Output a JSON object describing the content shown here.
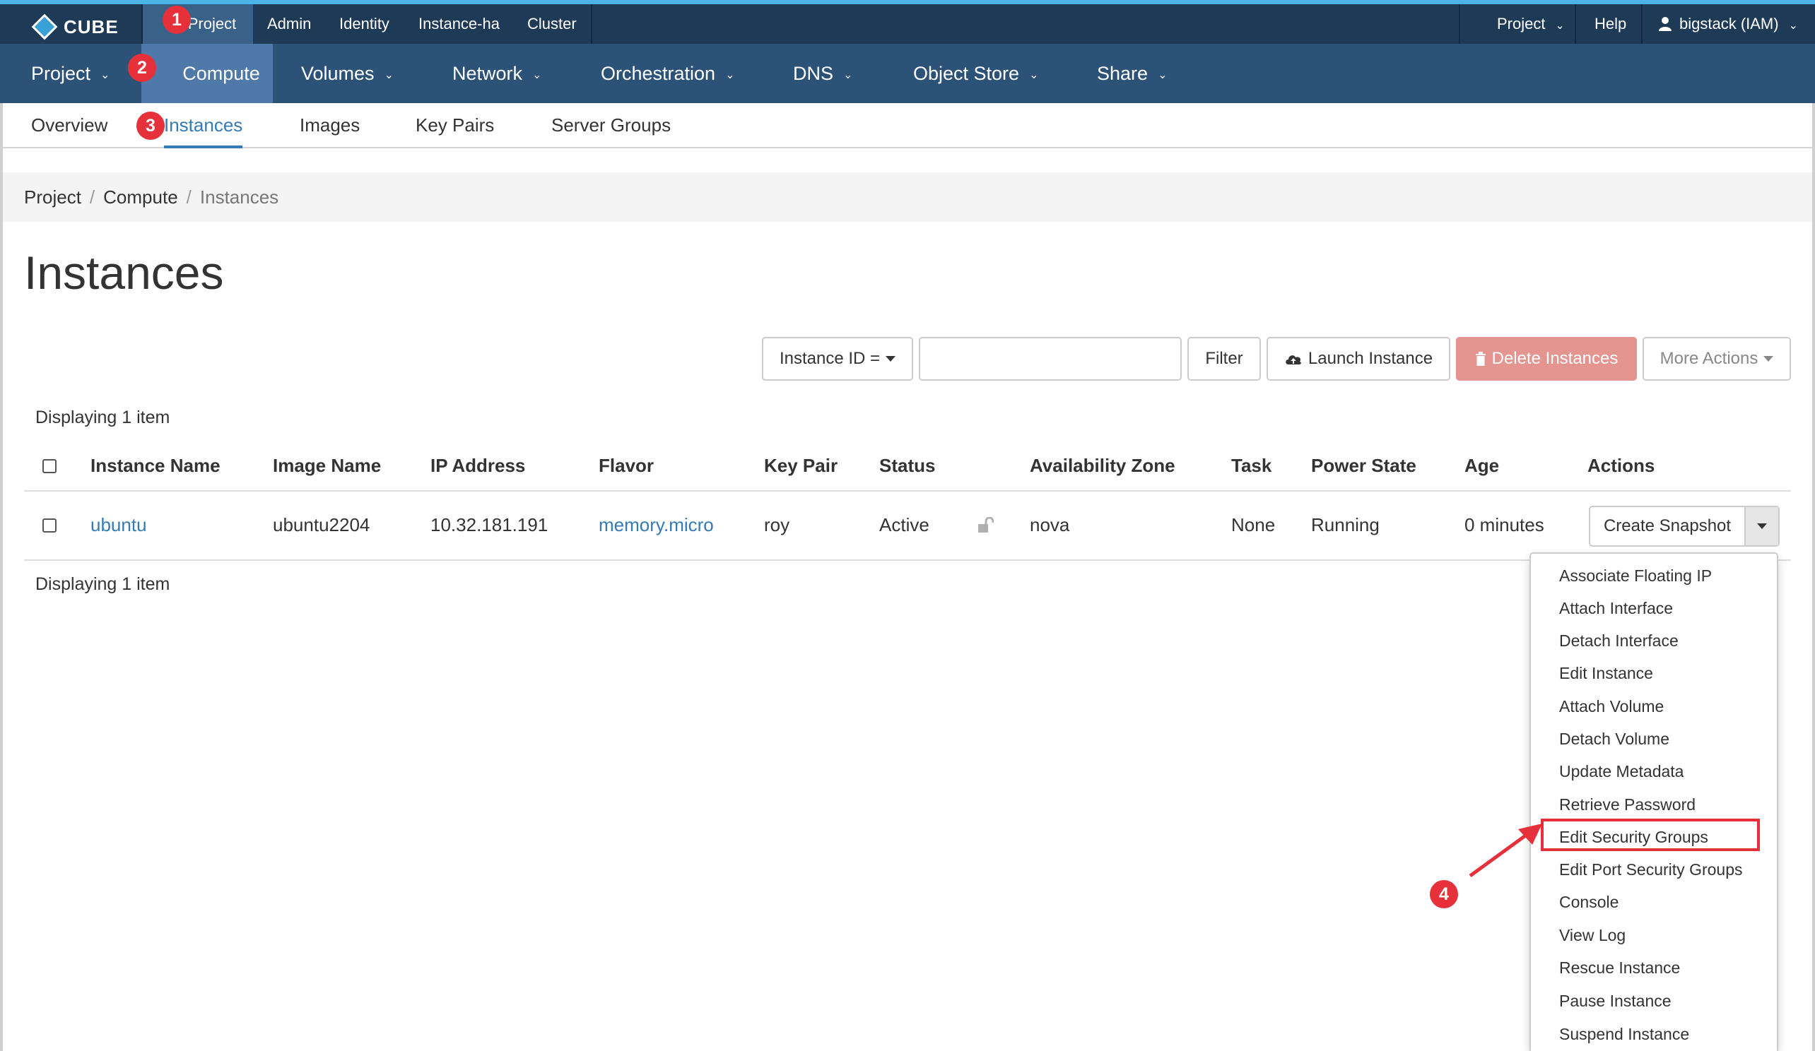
{
  "brand": {
    "name": "CUBE"
  },
  "top_nav": {
    "items": [
      "Project",
      "Admin",
      "Identity",
      "Instance-ha",
      "Cluster"
    ],
    "right": {
      "project_menu": "Project",
      "help": "Help",
      "user": "bigstack (IAM)"
    }
  },
  "main_nav": {
    "items": [
      "Project",
      "Compute",
      "Volumes",
      "Network",
      "Orchestration",
      "DNS",
      "Object Store",
      "Share"
    ]
  },
  "sub_nav": {
    "items": [
      "Overview",
      "Instances",
      "Images",
      "Key Pairs",
      "Server Groups"
    ]
  },
  "breadcrumb": [
    "Project",
    "Compute",
    "Instances"
  ],
  "page": {
    "title": "Instances"
  },
  "toolbar": {
    "filter_field": "Instance ID =",
    "filter_value": "",
    "filter_button": "Filter",
    "launch_button": "Launch Instance",
    "delete_button": "Delete Instances",
    "more_actions": "More Actions"
  },
  "table": {
    "count_label": "Displaying 1 item",
    "columns": [
      "Instance Name",
      "Image Name",
      "IP Address",
      "Flavor",
      "Key Pair",
      "Status",
      "Availability Zone",
      "Task",
      "Power State",
      "Age",
      "Actions"
    ],
    "rows": [
      {
        "name": "ubuntu",
        "image": "ubuntu2204",
        "ip": "10.32.181.191",
        "flavor": "memory.micro",
        "key_pair": "roy",
        "status": "Active",
        "zone": "nova",
        "task": "None",
        "power": "Running",
        "age": "0 minutes",
        "action": "Create Snapshot"
      }
    ]
  },
  "actions_menu": {
    "items": [
      "Associate Floating IP",
      "Attach Interface",
      "Detach Interface",
      "Edit Instance",
      "Attach Volume",
      "Detach Volume",
      "Update Metadata",
      "Retrieve Password",
      "Edit Security Groups",
      "Edit Port Security Groups",
      "Console",
      "View Log",
      "Rescue Instance",
      "Pause Instance",
      "Suspend Instance"
    ]
  },
  "annotations": {
    "step1": "1",
    "step2": "2",
    "step3": "3",
    "step4": "4"
  },
  "colors": {
    "top_bar": "#1e3a56",
    "main_nav": "#2c5277",
    "active_nav": "#4e79a8",
    "link": "#337ab7",
    "danger": "#e49590",
    "annotation": "#e6313a"
  }
}
